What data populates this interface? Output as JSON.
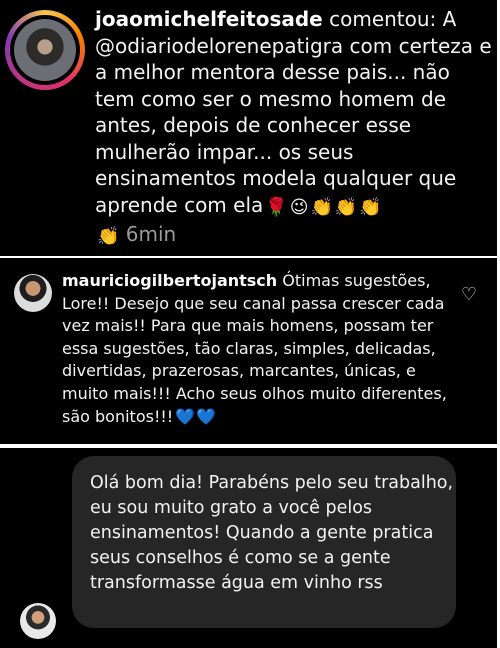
{
  "comment1": {
    "username": "joaomichelfeitosade",
    "text": "comentou: A @odiariodelorenepatigra com certeza e a melhor mentora desse pais... não tem como ser o mesmo homem de antes, depois de conhecer esse mulherão impar... os seus ensinamentos modela qualquer que aprende com ela",
    "emojis_line": [
      "rose",
      "wink",
      "clap",
      "clap",
      "clap"
    ],
    "time": "6min"
  },
  "comment2": {
    "username": "mauriciogilbertojantsch",
    "text": "Ótimas sugestões, Lore!! Desejo que seu canal passa crescer cada vez mais!! Para que mais homens, possam ter essa sugestões, tão claras, simples, delicadas, divertidas, prazerosas, marcantes, únicas, e muito mais!!! Acho seus olhos muito diferentes, são bonitos!!!",
    "hearts": "💙💙"
  },
  "message": {
    "text": "Olá bom dia! Parabéns pelo seu trabalho, eu sou muito grato a você pelos ensinamentos! Quando a gente pratica seus conselhos é como se a gente transformasse água em vinho rss"
  },
  "icons": [
    "avatar",
    "like-heart-icon"
  ],
  "colors": {
    "background": "#000000",
    "bubble": "#262626",
    "hearts": "#3b82f6"
  }
}
